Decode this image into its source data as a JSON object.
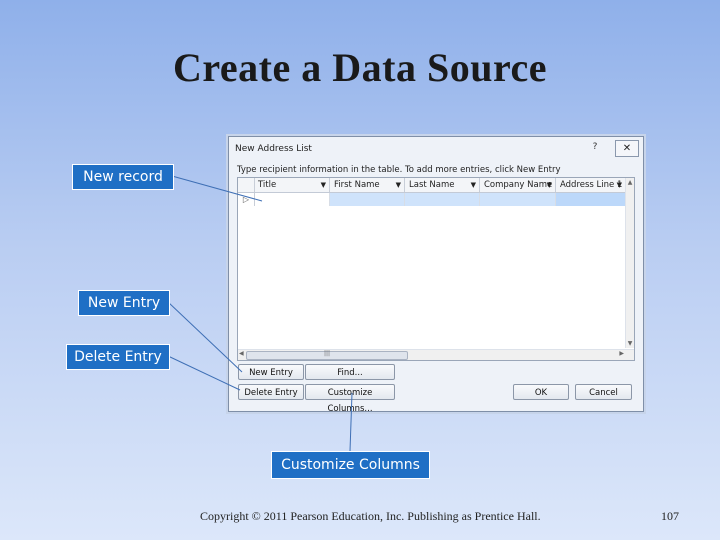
{
  "slide": {
    "title": "Create a Data Source",
    "footer": "Copyright © 2011 Pearson Education, Inc. Publishing as Prentice Hall.",
    "page_number": "107"
  },
  "callouts": {
    "new_record": "New record",
    "new_entry": "New Entry",
    "delete_entry": "Delete Entry",
    "customize_columns": "Customize Columns",
    "accent_color": "#1f6fc5"
  },
  "dialog": {
    "title": "New Address List",
    "help_icon": "?",
    "close_icon": "close-icon",
    "instructions": "Type recipient information in the table. To add more entries, click New Entry",
    "columns": [
      "Title",
      "First Name",
      "Last Name",
      "Company Name",
      "Address Line 1"
    ],
    "new_row_selector": "▷",
    "buttons": {
      "new_entry": "New Entry",
      "find": "Find...",
      "delete_entry": "Delete Entry",
      "customize_columns": "Customize Columns...",
      "ok": "OK",
      "cancel": "Cancel"
    }
  }
}
